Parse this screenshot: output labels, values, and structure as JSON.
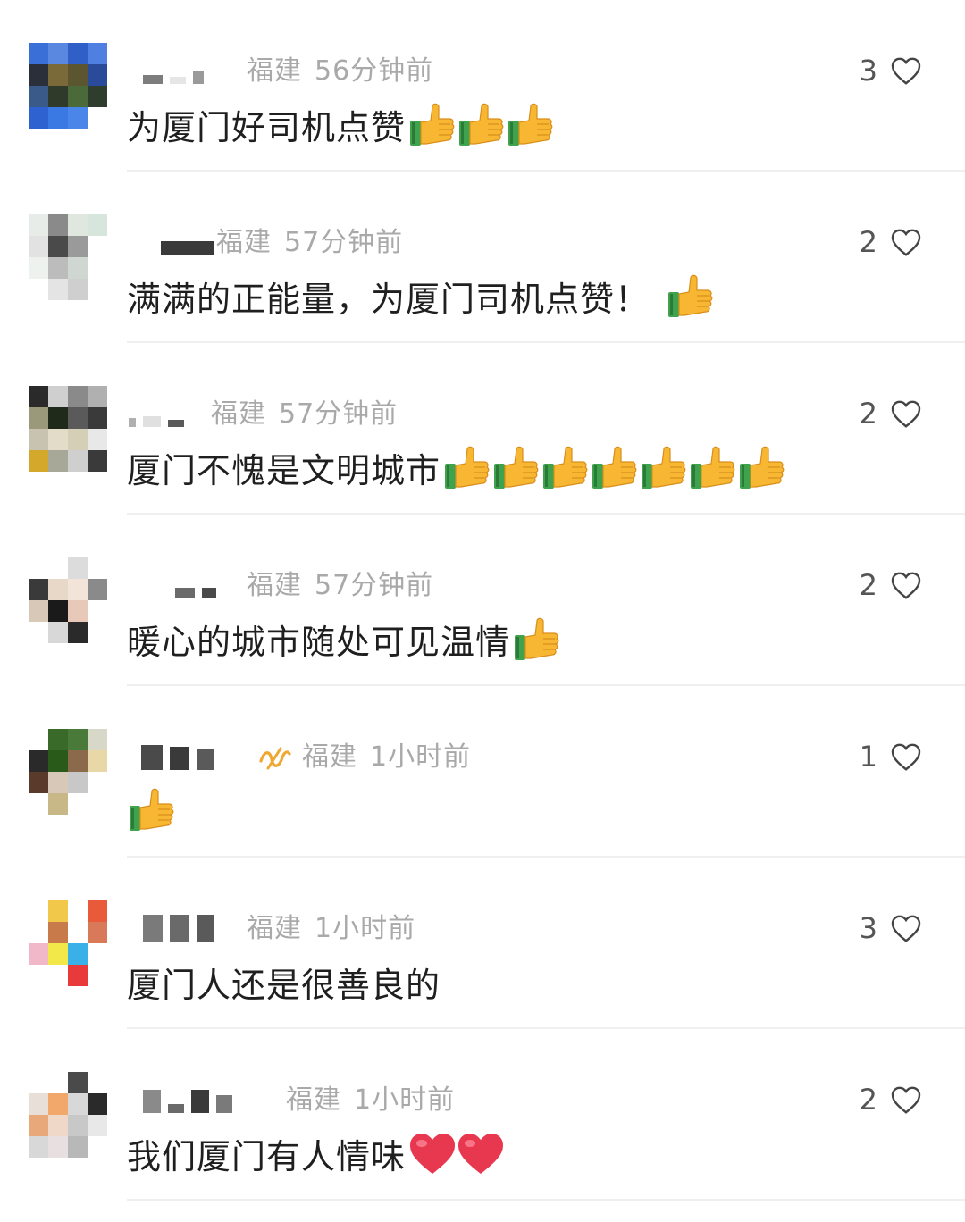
{
  "comments": [
    {
      "location": "福建",
      "time": "56分钟前",
      "text": "为厦门好司机点赞",
      "emoji_count": 3,
      "emoji": "thumbs-up",
      "likes": "3"
    },
    {
      "location": "福建",
      "time": "57分钟前",
      "text": "满满的正能量，为厦门司机点赞！",
      "emoji_count": 1,
      "emoji": "thumbs-up",
      "likes": "2"
    },
    {
      "location": "福建",
      "time": "57分钟前",
      "text": "厦门不愧是文明城市",
      "emoji_count": 7,
      "emoji": "thumbs-up",
      "likes": "2"
    },
    {
      "location": "福建",
      "time": "57分钟前",
      "text": "暖心的城市随处可见温情",
      "emoji_count": 1,
      "emoji": "thumbs-up",
      "likes": "2"
    },
    {
      "location": "福建",
      "time": "1小时前",
      "text": "",
      "emoji_count": 1,
      "emoji": "thumbs-up",
      "likes": "1",
      "badge_icon": "wave-badge-icon"
    },
    {
      "location": "福建",
      "time": "1小时前",
      "text": "厦门人还是很善良的",
      "emoji_count": 0,
      "emoji": "",
      "likes": "3"
    },
    {
      "location": "福建",
      "time": "1小时前",
      "text": "我们厦门有人情味",
      "emoji_count": 2,
      "emoji": "red-heart",
      "likes": "2"
    }
  ],
  "colors": {
    "meta": "#a9a9a9",
    "text": "#1f1f1f",
    "divider": "#efefef",
    "heart": "#e8384f",
    "thumb_skin": "#f7b733",
    "thumb_cuff": "#3fa34d"
  }
}
